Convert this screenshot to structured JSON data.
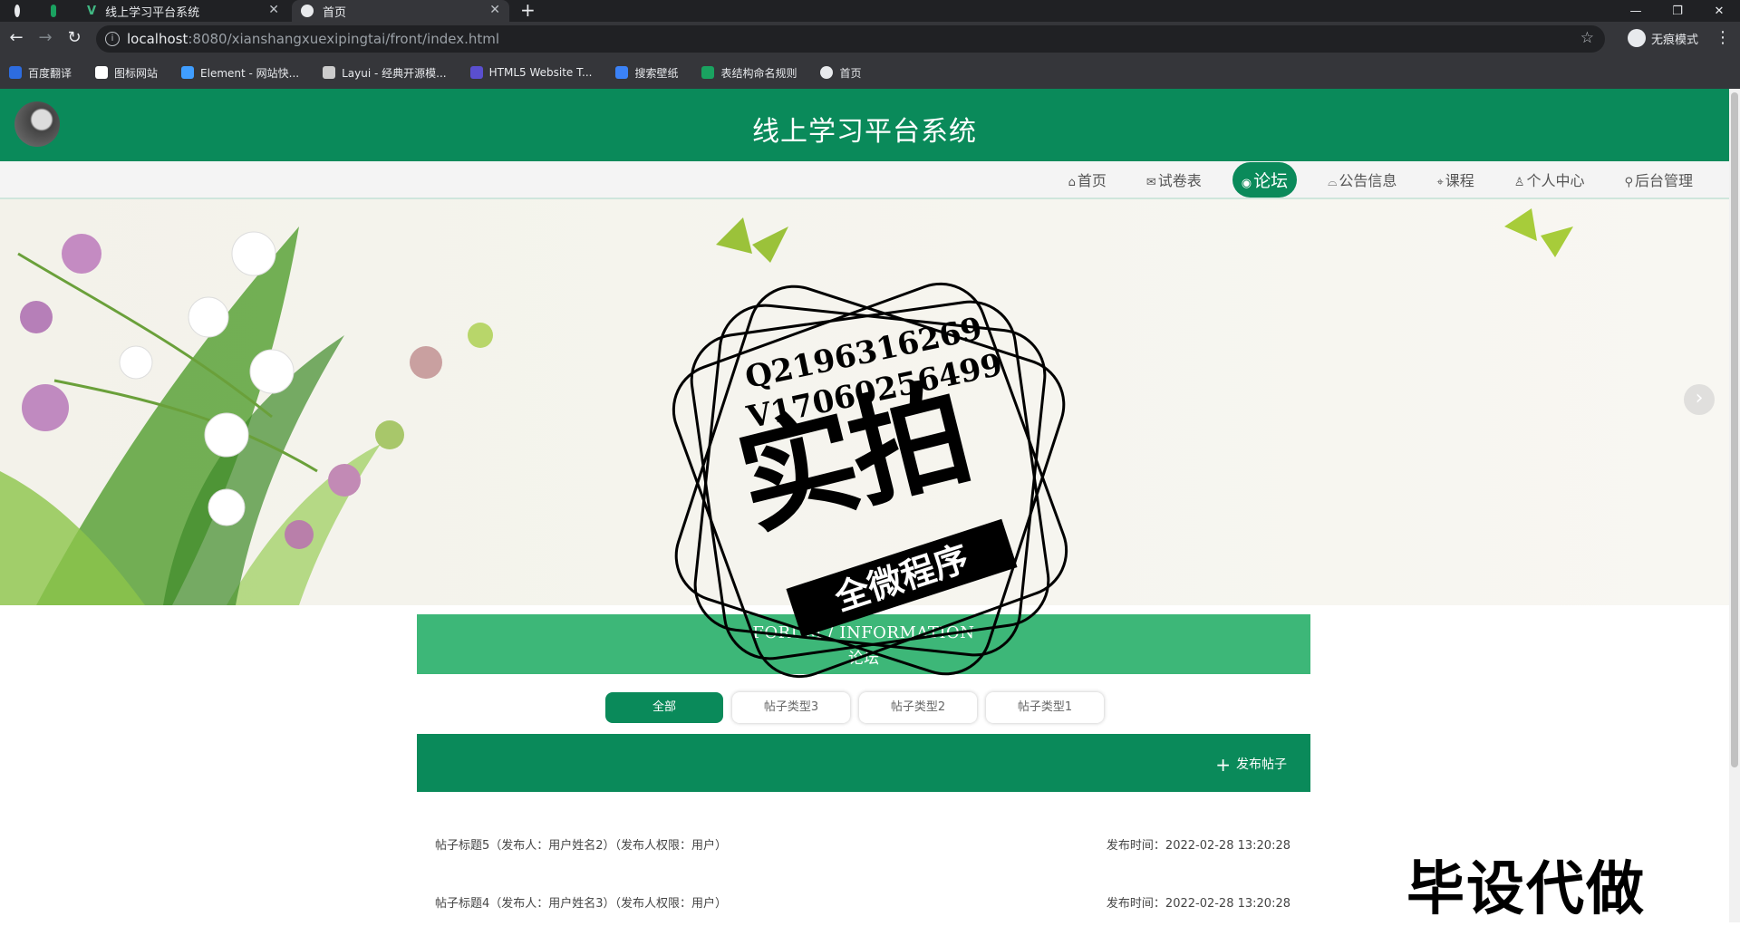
{
  "browser": {
    "tabs": [
      {
        "label": ""
      },
      {
        "label": ""
      },
      {
        "label": "线上学习平台系统"
      },
      {
        "label": "首页"
      }
    ],
    "url_host": "localhost",
    "url_path": ":8080/xianshangxuexipingtai/front/index.html",
    "incognito_label": "无痕模式",
    "bookmarks": [
      {
        "label": "百度翻译",
        "color": "#2d6cdf"
      },
      {
        "label": "图标网站",
        "color": "#ffffff"
      },
      {
        "label": "Element - 网站快...",
        "color": "#409eff"
      },
      {
        "label": "Layui - 经典开源模...",
        "color": "#cccccc"
      },
      {
        "label": "HTML5 Website T...",
        "color": "#5a4fcf"
      },
      {
        "label": "搜索壁纸",
        "color": "#3b82f6"
      },
      {
        "label": "表结构命名规则",
        "color": "#1aa260"
      },
      {
        "label": "首页",
        "color": "#e8eaed"
      }
    ]
  },
  "site": {
    "title": "线上学习平台系统",
    "brand_color": "#0a8a5a",
    "menu": [
      {
        "icon": "⌂",
        "label": "首页"
      },
      {
        "icon": "✉",
        "label": "试卷表"
      },
      {
        "icon": "◉",
        "label": "论坛"
      },
      {
        "icon": "⌓",
        "label": "公告信息"
      },
      {
        "icon": "⌖",
        "label": "课程"
      },
      {
        "icon": "♙",
        "label": "个人中心"
      },
      {
        "icon": "⚲",
        "label": "后台管理"
      }
    ],
    "active_menu": "论坛"
  },
  "forum": {
    "title_en": "FORUM / INFORMATION",
    "title_cn": "论坛",
    "filters": [
      "全部",
      "帖子类型3",
      "帖子类型2",
      "帖子类型1"
    ],
    "post_button": "发布帖子",
    "posts": [
      {
        "title": "帖子标题5（发布人：用户姓名2）（发布人权限：用户）",
        "time": "发布时间：2022-02-28 13:20:28"
      },
      {
        "title": "帖子标题4（发布人：用户姓名3）（发布人权限：用户）",
        "time": "发布时间：2022-02-28 13:20:28"
      }
    ]
  },
  "watermark": {
    "line1": "Q2196316269",
    "line2": "V17060256499",
    "big": "实拍",
    "ribbon": "全微程序",
    "corner": "毕设代做"
  }
}
